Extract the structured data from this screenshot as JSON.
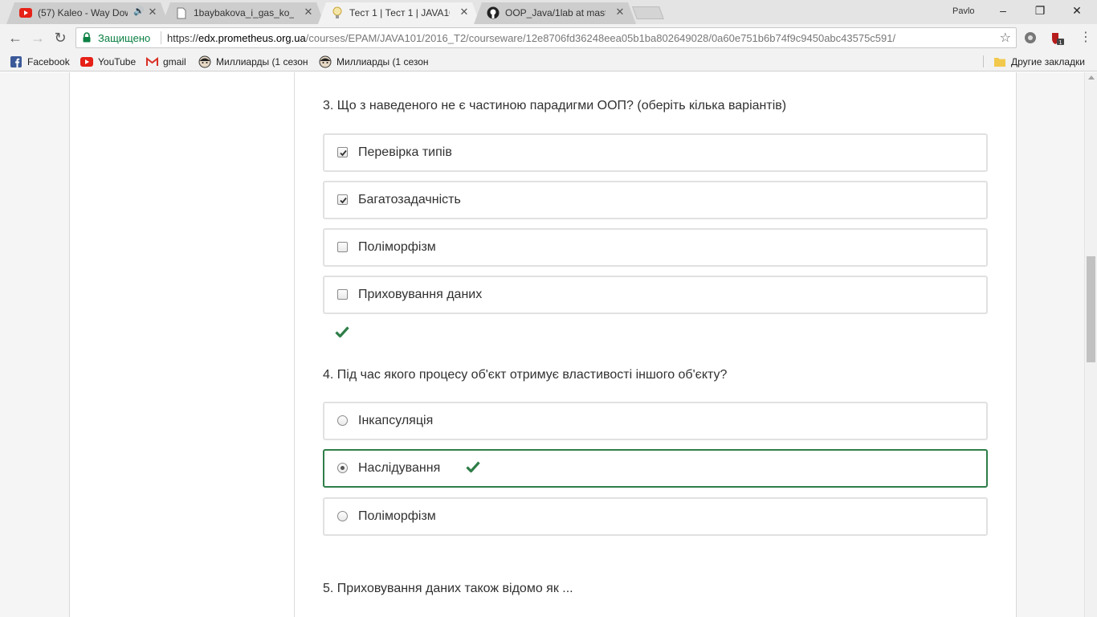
{
  "browser": {
    "tabs": [
      {
        "title": "(57) Kaleo - Way Dow",
        "icon": "youtube-icon",
        "audio": true
      },
      {
        "title": "1baybakova_i_gas_ko_o_",
        "icon": "document-icon"
      },
      {
        "title": "Тест 1 | Тест 1 | JAVA101",
        "icon": "lightbulb-icon",
        "active": true
      },
      {
        "title": "OOP_Java/1lab at maste",
        "icon": "github-icon"
      }
    ],
    "profile_name": "Pavlo",
    "security_label": "Защищено",
    "url_scheme": "https://",
    "url_host": "edx.prometheus.org.ua",
    "url_path": "/courses/EPAM/JAVA101/2016_T2/courseware/12e8706fd36248eea05b1ba802649028/0a60e751b6b74f9c9450abc43575c591/",
    "bookmarks": [
      {
        "label": "Facebook",
        "icon": "facebook-icon"
      },
      {
        "label": "YouTube",
        "icon": "youtube-icon"
      },
      {
        "label": "gmail",
        "icon": "gmail-icon"
      },
      {
        "label": "Миллиарды (1 сезон",
        "icon": "avatar-icon"
      },
      {
        "label": "Миллиарды (1 сезон",
        "icon": "avatar-icon"
      }
    ],
    "other_bookmarks": "Другие закладки",
    "colors": {
      "secure": "#0b8043",
      "correct": "#2e7d48"
    }
  },
  "quiz": {
    "q3": {
      "text": "3. Що з наведеного не є частиною парадигми ООП? (оберіть кілька варіантів)",
      "options": [
        {
          "label": "Перевірка типів",
          "checked": true
        },
        {
          "label": "Багатозадачність",
          "checked": true
        },
        {
          "label": "Поліморфізм",
          "checked": false
        },
        {
          "label": "Приховування даних",
          "checked": false
        }
      ],
      "status": "correct"
    },
    "q4": {
      "text": "4. Під час якого процесу об'єкт отримує властивості іншого об'єкту?",
      "options": [
        {
          "label": "Інкапсуляція",
          "selected": false
        },
        {
          "label": "Наслідування",
          "selected": true,
          "status": "correct"
        },
        {
          "label": "Поліморфізм",
          "selected": false
        }
      ]
    },
    "q5": {
      "text": "5. Приховування даних також відомо як ..."
    }
  }
}
